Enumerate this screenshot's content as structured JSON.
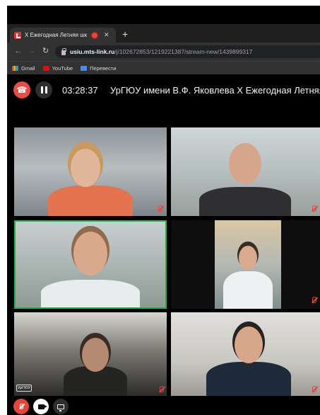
{
  "browser": {
    "tab": {
      "title": "X Ежегодная Летняя шк"
    },
    "address": {
      "host": "usiu.mts-link.ru",
      "path": "/j/102672853/1219221387/stream-new/1439899317"
    },
    "bookmarks": [
      {
        "label": "Gmail",
        "icon": "gmail-icon"
      },
      {
        "label": "YouTube",
        "icon": "youtube-icon"
      },
      {
        "label": "Перевести",
        "icon": "translate-icon"
      }
    ]
  },
  "meeting": {
    "timer": "03:28:37",
    "title": "УрГЮУ имени В.Ф. Яковлева   X Ежегодная Летняя"
  },
  "watermark": {
    "mark": "УрГЮУ"
  },
  "colors": {
    "end_call": "#ea4b45",
    "active_speaker": "#22b14c",
    "muted": "#e8443a"
  }
}
